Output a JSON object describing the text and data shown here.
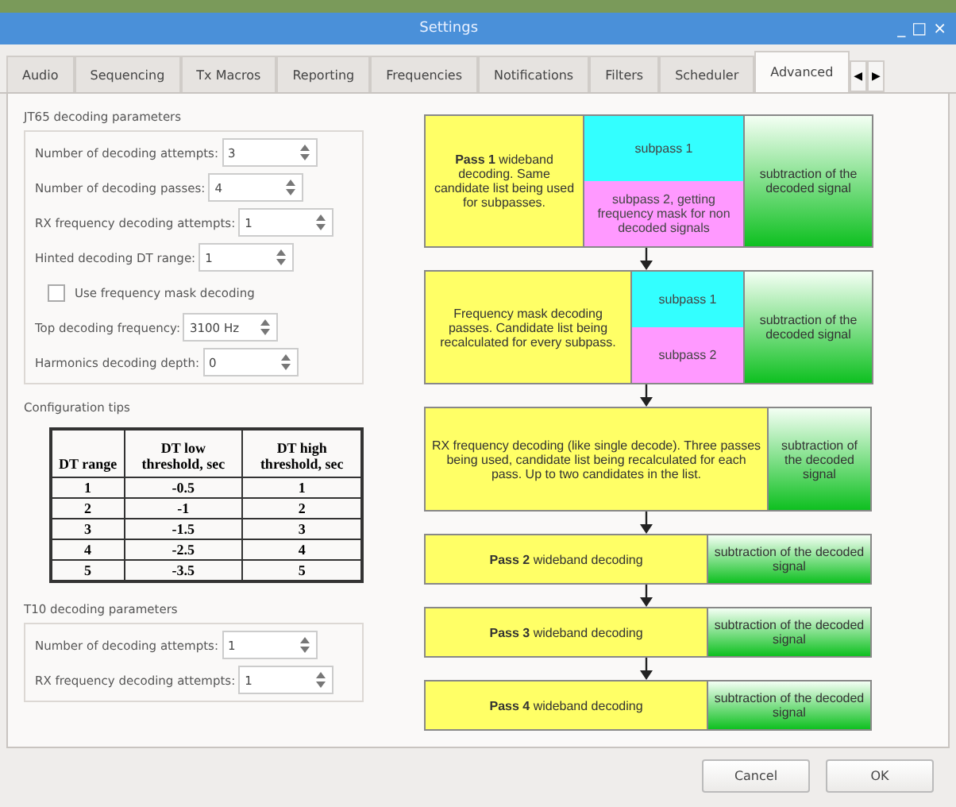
{
  "window": {
    "title": "Settings",
    "controls": [
      "_",
      "□",
      "×"
    ]
  },
  "tabs": [
    {
      "label": "Audio",
      "selected": false
    },
    {
      "label": "Sequencing",
      "selected": false
    },
    {
      "label": "Tx Macros",
      "selected": false
    },
    {
      "label": "Reporting",
      "selected": false
    },
    {
      "label": "Frequencies",
      "selected": false
    },
    {
      "label": "Notifications",
      "selected": false
    },
    {
      "label": "Filters",
      "selected": false
    },
    {
      "label": "Scheduler",
      "selected": false
    },
    {
      "label": "Advanced",
      "selected": true
    }
  ],
  "tab_scroll": [
    "◀",
    "▶"
  ],
  "jt65_group": {
    "title": "JT65 decoding parameters",
    "rows": [
      {
        "kind": "spin",
        "label": "Number of decoding attempts:",
        "value": "3"
      },
      {
        "kind": "spin",
        "label": "Number of decoding  passes:",
        "value": "4"
      },
      {
        "kind": "spin",
        "label": "RX frequency decoding attempts:",
        "value": "1"
      },
      {
        "kind": "spin",
        "label": "Hinted decoding DT range:",
        "value": "1"
      },
      {
        "kind": "check",
        "label": "Use frequency mask decoding",
        "checked": false
      },
      {
        "kind": "spin",
        "label": "Top decoding frequency:",
        "value": "3100 Hz"
      },
      {
        "kind": "spin",
        "label": "Harmonics decoding depth:",
        "value": "0"
      }
    ]
  },
  "tips": {
    "title": "Configuration tips",
    "table": {
      "columns": [
        "DT range",
        "DT low threshold, sec",
        "DT high threshold, sec"
      ],
      "rows": [
        [
          "1",
          "-0.5",
          "1"
        ],
        [
          "2",
          "-1",
          "2"
        ],
        [
          "3",
          "-1.5",
          "3"
        ],
        [
          "4",
          "-2.5",
          "4"
        ],
        [
          "5",
          "-3.5",
          "5"
        ]
      ]
    }
  },
  "t10_group": {
    "title": "T10 decoding parameters",
    "rows": [
      {
        "kind": "spin",
        "label": "Number of decoding attempts:",
        "value": "1"
      },
      {
        "kind": "spin",
        "label": "RX frequency decoding attempts:",
        "value": "1"
      }
    ]
  },
  "flow": [
    {
      "text": "**Pass 1** wideband decoding. Same candidate list being used for subpasses.",
      "subpasses": [
        {
          "text": "subpass 1",
          "color": "#33ffff"
        },
        {
          "text": "subpass 2, getting frequency mask for non decoded signals",
          "color": "#ff99ff"
        }
      ],
      "result": "subtraction of the decoded signal"
    },
    {
      "text": "Frequency mask decoding passes. Candidate list being recalculated for every subpass.",
      "subpasses": [
        {
          "text": "subpass 1",
          "color": "#33ffff"
        },
        {
          "text": "subpass 2",
          "color": "#ff99ff"
        }
      ],
      "result": "subtraction of the decoded signal"
    },
    {
      "text": "RX frequency decoding (like single decode). Three passes being used, candidate list being recalculated for each pass. Up to two candidates in the list.",
      "result": "subtraction of the decoded signal"
    },
    {
      "text": "**Pass 2** wideband decoding",
      "result": "subtraction of the decoded signal"
    },
    {
      "text": "**Pass 3** wideband decoding",
      "result": "subtraction of the decoded signal"
    },
    {
      "text": "**Pass 4** wideband decoding",
      "result": "subtraction of the decoded signal"
    }
  ],
  "buttons": [
    "Cancel",
    "OK"
  ]
}
